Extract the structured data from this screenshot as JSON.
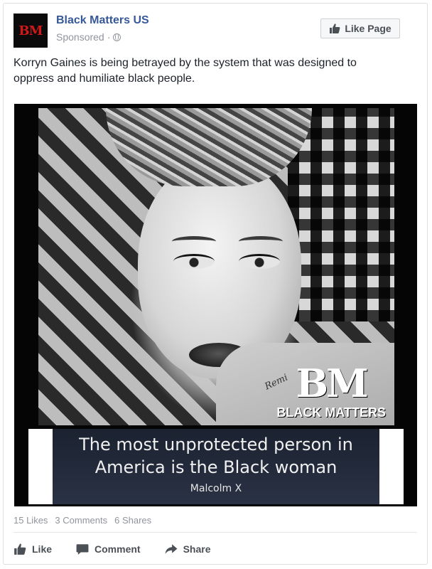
{
  "post": {
    "page_name": "Black Matters US",
    "avatar_text": "BM",
    "sponsored_label": "Sponsored",
    "separator": "·",
    "privacy_icon": "globe-icon",
    "like_page_label": "Like Page",
    "text": "Korryn Gaines is being betrayed by the system that was designed to oppress and humiliate black people."
  },
  "image": {
    "tattoo_text": "Remi",
    "logo_mark": "BM",
    "logo_word": "BLACK MATTERS",
    "quote_line1": "The most unprotected person in",
    "quote_line2": "America is the Black woman",
    "quote_author": "Malcolm X"
  },
  "stats": {
    "likes": "15 Likes",
    "comments": "3 Comments",
    "shares": "6 Shares"
  },
  "actions": {
    "like": "Like",
    "comment": "Comment",
    "share": "Share"
  },
  "colors": {
    "link": "#365899",
    "muted": "#90949c",
    "action_text": "#4b4f56"
  }
}
